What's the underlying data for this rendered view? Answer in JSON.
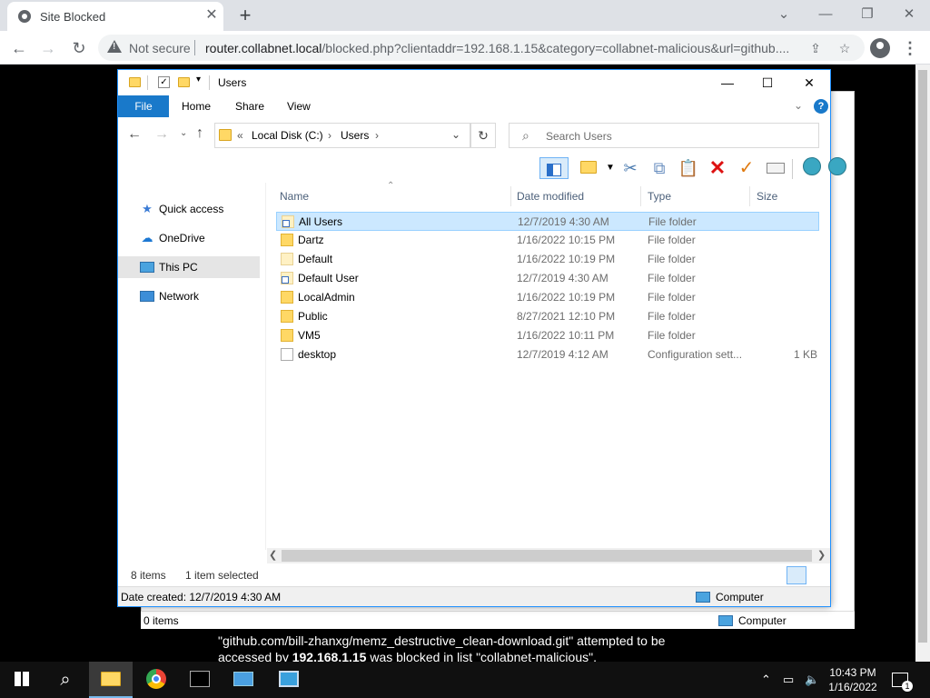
{
  "browser": {
    "tab_title": "Site Blocked",
    "tab_close": "✕",
    "new_tab": "+",
    "not_secure": "Not secure",
    "url_host": "router.collabnet.local",
    "url_rest": "/blocked.php?clientaddr=192.168.1.15&category=collabnet-malicious&url=github...."
  },
  "block_message": {
    "line1": "\"github.com/bill-zhanxg/memz_destructive_clean-download.git\" attempted to be",
    "accessed_by": "accessed by",
    "ip": "192.168.1.15",
    "blocked_in": "was blocked in list \"collabnet-malicious\"."
  },
  "behind_window": {
    "status_items": "0 items",
    "status_location": "Computer"
  },
  "explorer": {
    "title": "Users",
    "ribbon": {
      "file": "File",
      "home": "Home",
      "share": "Share",
      "view": "View"
    },
    "breadcrumb": {
      "overflow": "«",
      "drive": "Local Disk (C:)",
      "folder": "Users"
    },
    "search_placeholder": "Search Users",
    "nav": [
      {
        "label": "Quick access",
        "icon": "star-icon"
      },
      {
        "label": "OneDrive",
        "icon": "cloud-icon"
      },
      {
        "label": "This PC",
        "icon": "computer-icon",
        "selected": true
      },
      {
        "label": "Network",
        "icon": "network-icon"
      }
    ],
    "columns": {
      "name": "Name",
      "date": "Date modified",
      "type": "Type",
      "size": "Size"
    },
    "files": [
      {
        "name": "All Users",
        "date": "12/7/2019 4:30 AM",
        "type": "File folder",
        "size": "",
        "icon": "folder-shortcut-icon",
        "selected": true
      },
      {
        "name": "Dartz",
        "date": "1/16/2022 10:15 PM",
        "type": "File folder",
        "size": "",
        "icon": "folder-icon"
      },
      {
        "name": "Default",
        "date": "1/16/2022 10:19 PM",
        "type": "File folder",
        "size": "",
        "icon": "folder-hidden-icon"
      },
      {
        "name": "Default User",
        "date": "12/7/2019 4:30 AM",
        "type": "File folder",
        "size": "",
        "icon": "folder-shortcut-icon"
      },
      {
        "name": "LocalAdmin",
        "date": "1/16/2022 10:19 PM",
        "type": "File folder",
        "size": "",
        "icon": "folder-icon"
      },
      {
        "name": "Public",
        "date": "8/27/2021 12:10 PM",
        "type": "File folder",
        "size": "",
        "icon": "folder-icon"
      },
      {
        "name": "VM5",
        "date": "1/16/2022 10:11 PM",
        "type": "File folder",
        "size": "",
        "icon": "folder-icon"
      },
      {
        "name": "desktop",
        "date": "12/7/2019 4:12 AM",
        "type": "Configuration sett...",
        "size": "1 KB",
        "icon": "config-file-icon"
      }
    ],
    "status_count": "8 items",
    "status_selected": "1 item selected",
    "details_text": "Date created: 12/7/2019 4:30 AM",
    "details_location": "Computer"
  },
  "taskbar": {
    "time": "10:43 PM",
    "date": "1/16/2022",
    "notif_count": "1"
  },
  "colors": {
    "accent": "#1979ca",
    "selection": "#cce8ff",
    "folder": "#ffd865"
  }
}
